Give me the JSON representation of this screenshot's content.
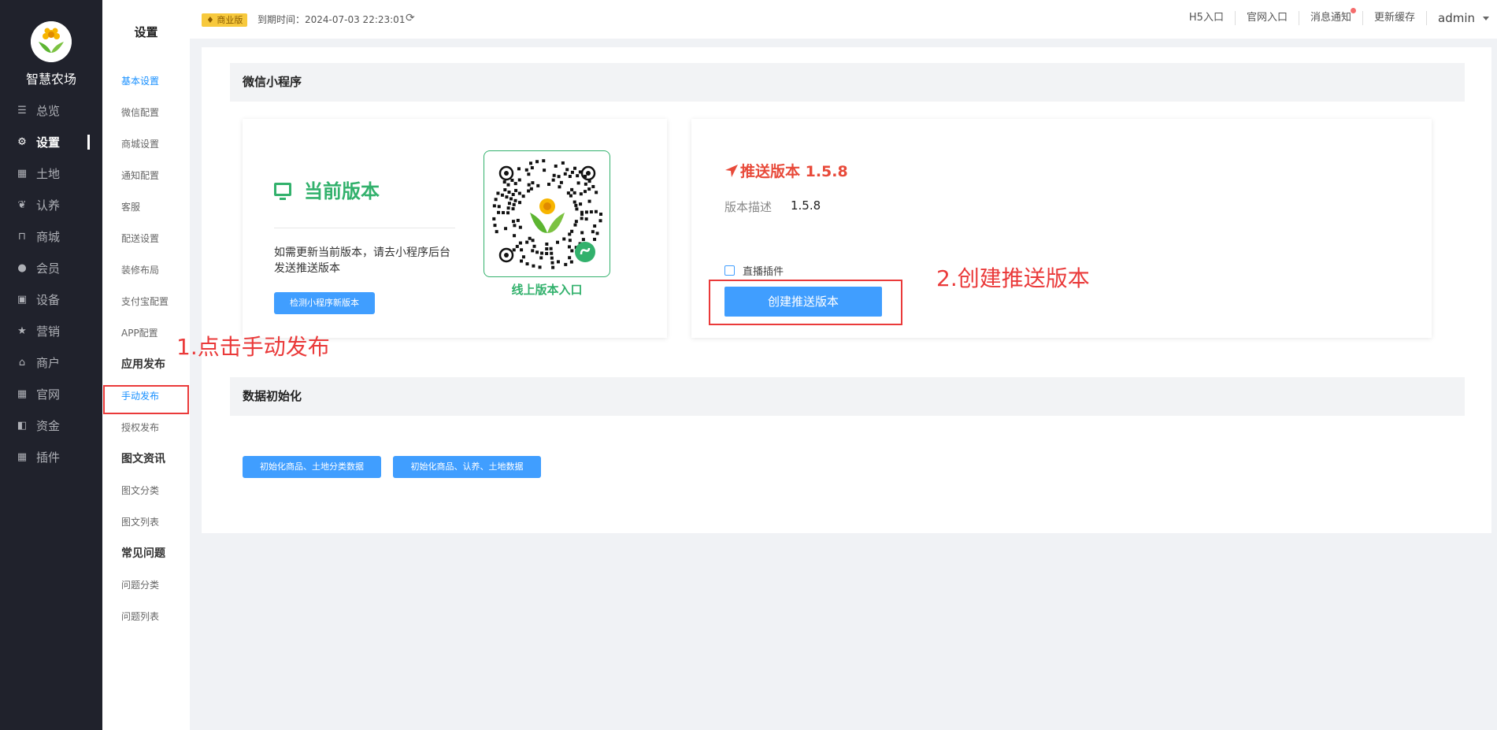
{
  "app": {
    "name": "智慧农场"
  },
  "sidebar": {
    "items": [
      {
        "label": "总览",
        "icon": "sliders-icon"
      },
      {
        "label": "设置",
        "icon": "gear-icon",
        "active": true
      },
      {
        "label": "土地",
        "icon": "grid-icon"
      },
      {
        "label": "认养",
        "icon": "sprout-icon"
      },
      {
        "label": "商城",
        "icon": "shopping-bag-icon"
      },
      {
        "label": "会员",
        "icon": "user-icon"
      },
      {
        "label": "设备",
        "icon": "truck-icon"
      },
      {
        "label": "营销",
        "icon": "star-icon"
      },
      {
        "label": "商户",
        "icon": "store-icon"
      },
      {
        "label": "官网",
        "icon": "grid-icon"
      },
      {
        "label": "资金",
        "icon": "wallet-icon"
      },
      {
        "label": "插件",
        "icon": "grid-icon"
      }
    ]
  },
  "submenu": {
    "title": "设置",
    "entries": [
      {
        "type": "item",
        "label": "基本设置",
        "active": true
      },
      {
        "type": "item",
        "label": "微信配置"
      },
      {
        "type": "item",
        "label": "商城设置"
      },
      {
        "type": "item",
        "label": "通知配置"
      },
      {
        "type": "item",
        "label": "客服"
      },
      {
        "type": "item",
        "label": "配送设置"
      },
      {
        "type": "item",
        "label": "装修布局"
      },
      {
        "type": "item",
        "label": "支付宝配置"
      },
      {
        "type": "item",
        "label": "APP配置"
      },
      {
        "type": "group",
        "label": "应用发布"
      },
      {
        "type": "item",
        "label": "手动发布",
        "active": true
      },
      {
        "type": "item",
        "label": "授权发布"
      },
      {
        "type": "group",
        "label": "图文资讯"
      },
      {
        "type": "item",
        "label": "图文分类"
      },
      {
        "type": "item",
        "label": "图文列表"
      },
      {
        "type": "group",
        "label": "常见问题"
      },
      {
        "type": "item",
        "label": "问题分类"
      },
      {
        "type": "item",
        "label": "问题列表"
      }
    ]
  },
  "header": {
    "badge": "商业版",
    "expire_label": "到期时间：2024-07-03 22:23:01",
    "links": [
      "H5入口",
      "官网入口",
      "消息通知",
      "更新缓存"
    ],
    "user": "admin"
  },
  "mini_program": {
    "section_title": "微信小程序",
    "current": {
      "title": "当前版本",
      "desc": "如需更新当前版本，请去小程序后台发送推送版本",
      "check_button": "检测小程序新版本",
      "qr_label": "线上版本入口"
    },
    "push": {
      "title": "推送版本 1.5.8",
      "desc_label": "版本描述",
      "desc_value": "1.5.8",
      "checkbox_label": "直播插件",
      "create_button": "创建推送版本"
    }
  },
  "data_init": {
    "section_title": "数据初始化",
    "buttons": [
      "初始化商品、土地分类数据",
      "初始化商品、认养、土地数据"
    ]
  },
  "annotations": {
    "step1": "1.点击手动发布",
    "step2": "2.创建推送版本"
  },
  "colors": {
    "sidebar_bg": "#20222c",
    "primary": "#409eff",
    "green": "#32b16c",
    "red": "#e84a3a",
    "annotation": "#ea3a3a"
  }
}
